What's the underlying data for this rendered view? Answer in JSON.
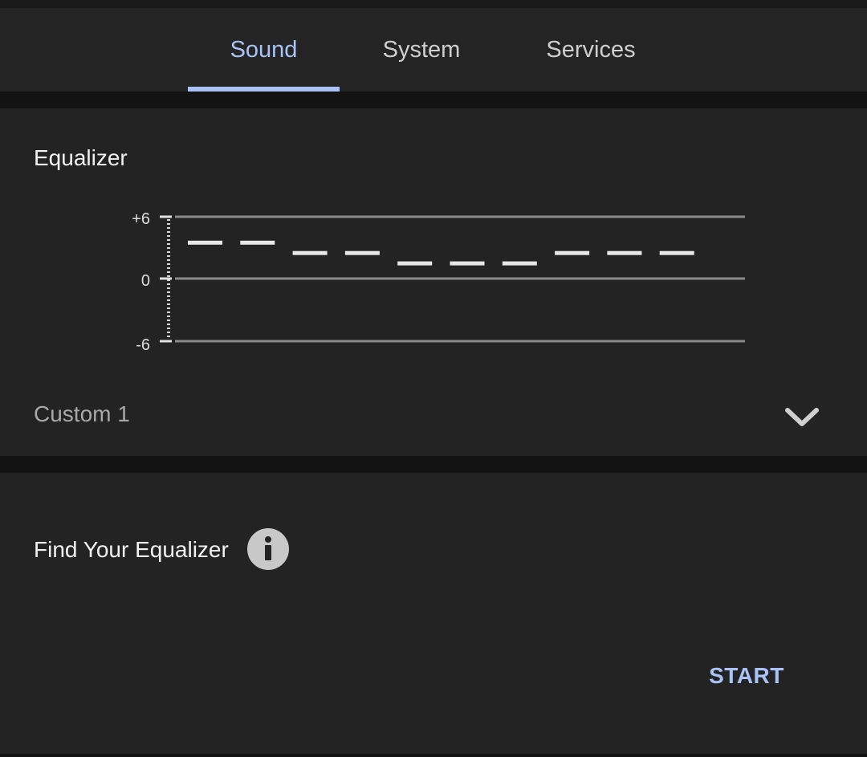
{
  "tabs": [
    {
      "label": "Sound",
      "active": true
    },
    {
      "label": "System",
      "active": false
    },
    {
      "label": "Services",
      "active": false
    }
  ],
  "equalizer": {
    "title": "Equalizer",
    "scale_labels": [
      "+6",
      "0",
      "-6"
    ],
    "scale_min": -6,
    "scale_max": 6,
    "band_levels_db": [
      3.5,
      3.5,
      2.5,
      2.5,
      1.5,
      1.5,
      1.5,
      2.5,
      2.5,
      2.5
    ],
    "preset": "Custom 1",
    "preset_icon": "chevron-down-icon"
  },
  "find_equalizer": {
    "title": "Find Your Equalizer",
    "info_icon": "info-icon",
    "start_label": "START"
  },
  "colors": {
    "accent": "#a8c3f5",
    "background": "#131313",
    "card": "#232323",
    "band_marker": "#e8e8e8"
  }
}
